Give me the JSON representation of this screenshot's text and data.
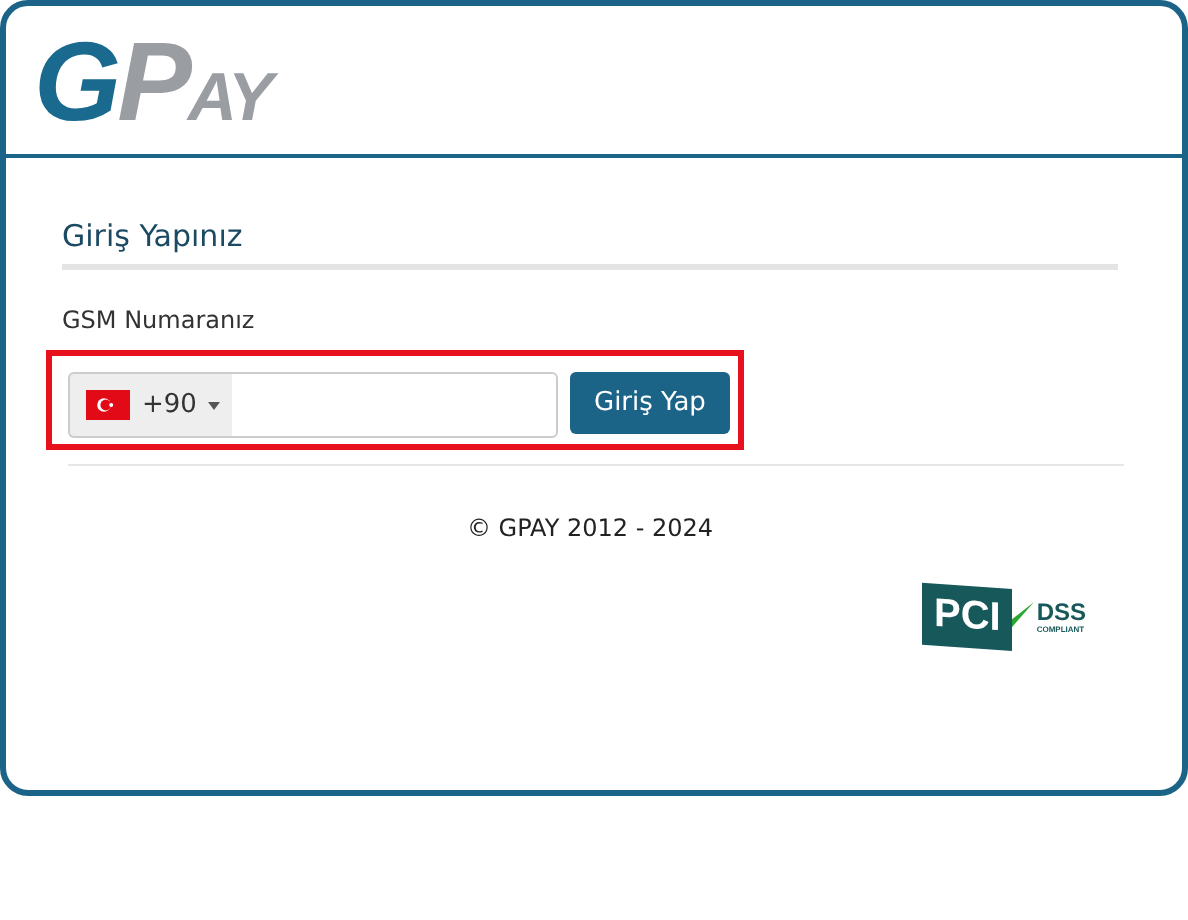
{
  "logo": {
    "letters": [
      {
        "text": "G",
        "color": "#1a6a8f"
      },
      {
        "text": "P",
        "color": "#9a9ea2"
      },
      {
        "text": "AY",
        "color": "#9a9ea2"
      }
    ]
  },
  "form": {
    "title": "Giriş Yapınız",
    "label": "GSM Numaranız",
    "country_code": "+90",
    "highlighted": true,
    "button": "Giriş Yap"
  },
  "footer": {
    "copyright": "© GPAY 2012 - 2024",
    "badge": {
      "main": "PCI",
      "dss": "DSS",
      "compliant": "COMPLIANT"
    }
  }
}
